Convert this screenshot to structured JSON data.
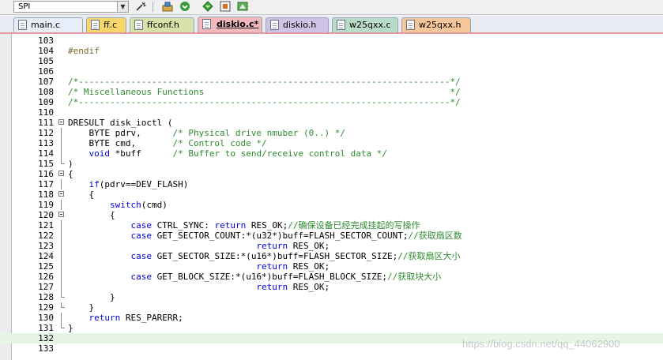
{
  "toolbar": {
    "target_value": "SPI"
  },
  "tabs": [
    {
      "label": "main.c",
      "color": "#e8eef9",
      "active": false
    },
    {
      "label": "ff.c",
      "color": "#f8d76a",
      "active": false
    },
    {
      "label": "ffconf.h",
      "color": "#d8e2a8",
      "active": false
    },
    {
      "label": "diskio.c*",
      "color": "#f2b9bc",
      "active": true
    },
    {
      "label": "diskio.h",
      "color": "#cfc4e6",
      "active": false
    },
    {
      "label": "w25qxx.c",
      "color": "#b9dcc8",
      "active": false
    },
    {
      "label": "w25qxx.h",
      "color": "#f6c59a",
      "active": false
    }
  ],
  "lines": [
    {
      "n": "103",
      "t": ""
    },
    {
      "n": "104",
      "t": "#endif"
    },
    {
      "n": "105",
      "t": ""
    },
    {
      "n": "106",
      "t": ""
    },
    {
      "n": "107",
      "t": "/*-----------------------------------------------------------------------*/"
    },
    {
      "n": "108",
      "t": "/* Miscellaneous Functions                                               */"
    },
    {
      "n": "109",
      "t": "/*-----------------------------------------------------------------------*/"
    },
    {
      "n": "110",
      "t": ""
    },
    {
      "n": "111",
      "t": "DRESULT disk_ioctl ("
    },
    {
      "n": "112",
      "t": "    BYTE pdrv,      /* Physical drive nmuber (0..) */"
    },
    {
      "n": "113",
      "t": "    BYTE cmd,       /* Control code */"
    },
    {
      "n": "114",
      "t": "    void *buff      /* Buffer to send/receive control data */"
    },
    {
      "n": "115",
      "t": ")"
    },
    {
      "n": "116",
      "t": "{"
    },
    {
      "n": "117",
      "t": "    if(pdrv==DEV_FLASH)"
    },
    {
      "n": "118",
      "t": "    {"
    },
    {
      "n": "119",
      "t": "        switch(cmd)"
    },
    {
      "n": "120",
      "t": "        {"
    },
    {
      "n": "121",
      "t": "            case CTRL_SYNC: return RES_OK;//确保设备已经完成挂起的写操作"
    },
    {
      "n": "122",
      "t": "            case GET_SECTOR_COUNT:*(u32*)buff=FLASH_SECTOR_COUNT;//获取扇区数"
    },
    {
      "n": "123",
      "t": "                                    return RES_OK;"
    },
    {
      "n": "124",
      "t": "            case GET_SECTOR_SIZE:*(u16*)buff=FLASH_SECTOR_SIZE;//获取扇区大小"
    },
    {
      "n": "125",
      "t": "                                    return RES_OK;"
    },
    {
      "n": "126",
      "t": "            case GET_BLOCK_SIZE:*(u16*)buff=FLASH_BLOCK_SIZE;//获取块大小"
    },
    {
      "n": "127",
      "t": "                                    return RES_OK;"
    },
    {
      "n": "128",
      "t": "        }"
    },
    {
      "n": "129",
      "t": "    }"
    },
    {
      "n": "130",
      "t": "    return RES_PARERR;"
    },
    {
      "n": "131",
      "t": "}"
    },
    {
      "n": "132",
      "t": ""
    },
    {
      "n": "133",
      "t": ""
    }
  ],
  "watermark": "https://blog.csdn.net/qq_44062900"
}
